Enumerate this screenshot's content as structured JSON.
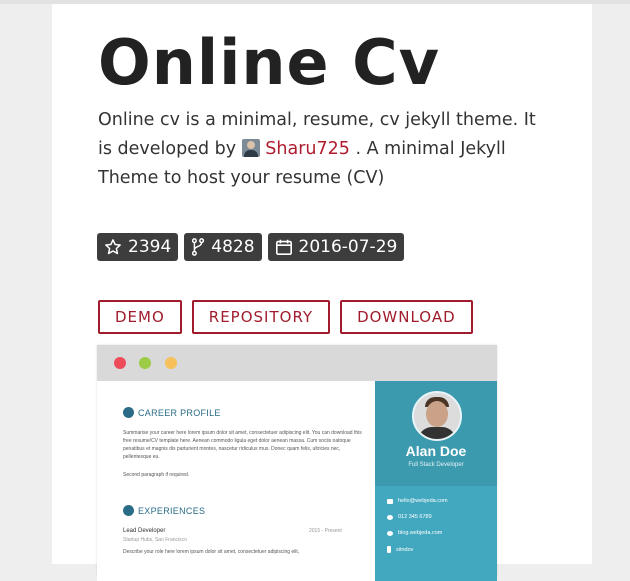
{
  "theme": {
    "title": "Online Cv",
    "description_before": "Online cv is a minimal, resume, cv jekyll theme. It is developed by",
    "author": "Sharu725",
    "description_after": ". A minimal Jekyll Theme to host your resume (CV)"
  },
  "stats": {
    "stars": "2394",
    "forks": "4828",
    "date": "2016-07-29"
  },
  "buttons": {
    "demo": "DEMO",
    "repository": "REPOSITORY",
    "download": "DOWNLOAD"
  },
  "preview": {
    "career_profile": "CAREER PROFILE",
    "career_text": "Summarise your career here lorem ipsum dolor sit amet, consectetuer adipiscing elit. You can download this free resume/CV template here. Aenean commodo ligula eget dolor aenean massa. Cum sociis natoque penatibus et magnis dis parturient montes, nascetur ridiculus mus. Donec quam felis, ultricies nec, pellentesque eu.",
    "career_text_2": "Second paragraph if required.",
    "experiences": "EXPERIENCES",
    "job_title": "Lead Developer",
    "job_company": "Startup Hubs, San Francisco",
    "job_dates": "2015 - Present",
    "job_desc": "Describe your role here lorem ipsum dolor sit amet, consectetuer adipiscing elit,",
    "name": "Alan Doe",
    "role": "Full Stack Developer",
    "email": "hello@webjeda.com",
    "phone": "012 345 6789",
    "website": "blog.webjeda.com",
    "handle": "sitndov"
  },
  "colors": {
    "accent": "#a01c2c",
    "badge": "#3d3d3d",
    "sidebar": "#42a8c0"
  }
}
